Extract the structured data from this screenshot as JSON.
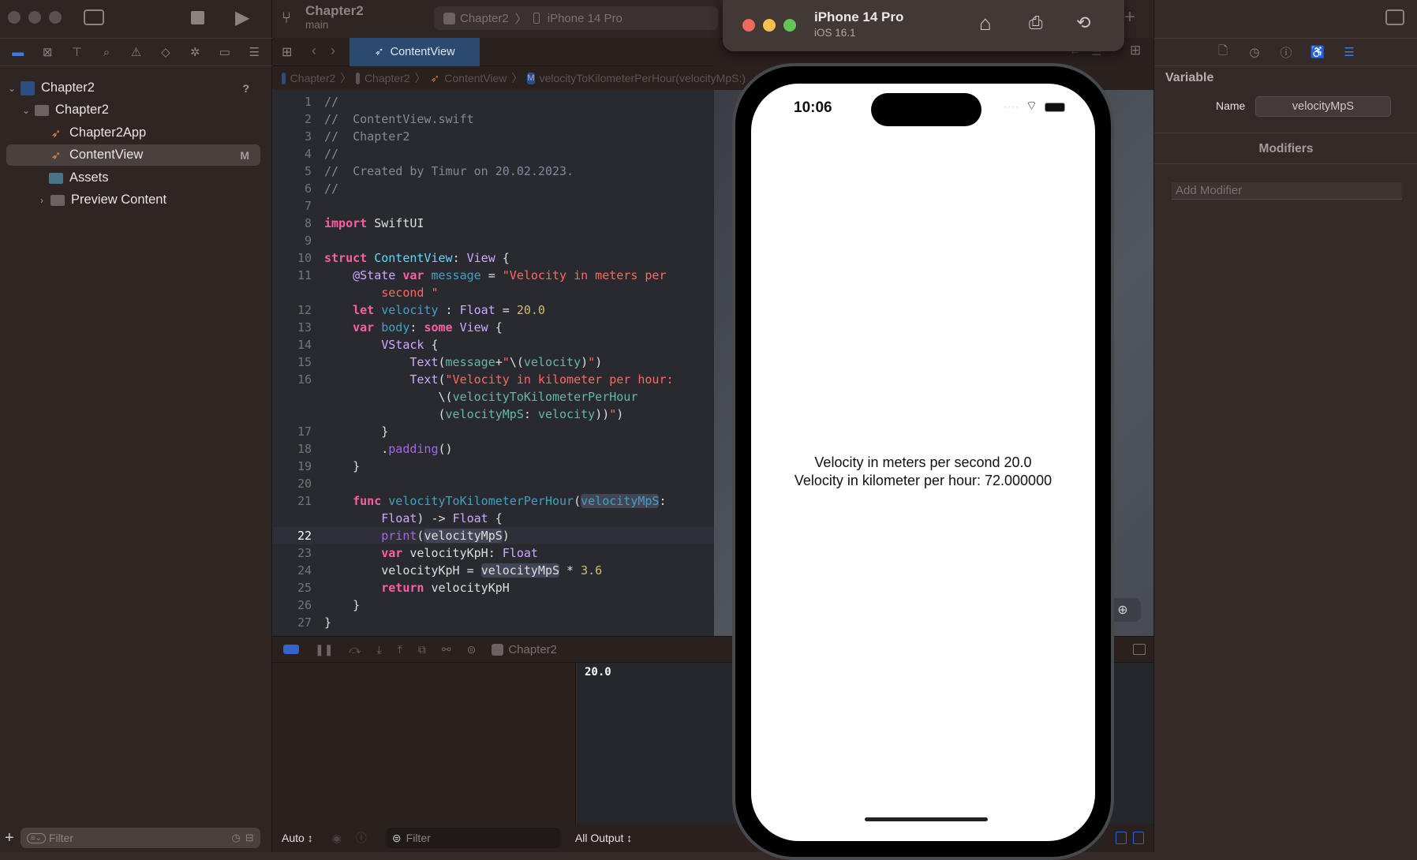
{
  "toolbar": {
    "project": "Chapter2",
    "branch": "main",
    "scheme": "Chapter2",
    "destination": "iPhone 14 Pro",
    "add": "+"
  },
  "navigator": {
    "tree": [
      {
        "label": "Chapter2",
        "badge": "?",
        "kind": "project",
        "expanded": true
      },
      {
        "label": "Chapter2",
        "kind": "folder",
        "expanded": true
      },
      {
        "label": "Chapter2App",
        "kind": "swift"
      },
      {
        "label": "ContentView",
        "kind": "swift",
        "badge": "M",
        "selected": true
      },
      {
        "label": "Assets",
        "kind": "assets"
      },
      {
        "label": "Preview Content",
        "kind": "folder",
        "expanded": false
      }
    ],
    "filter_placeholder": "Filter",
    "add": "+"
  },
  "editor": {
    "tab": "ContentView",
    "breadcrumb": [
      "Chapter2",
      "Chapter2",
      "ContentView",
      "velocityToKilometerPerHour(velocityMpS:)"
    ],
    "breadcrumb_method_badge": "M",
    "current_line": 22,
    "lines": [
      {
        "n": "1",
        "html": "<span class='cm'>//</span>"
      },
      {
        "n": "2",
        "html": "<span class='cm'>//  ContentView.swift</span>"
      },
      {
        "n": "3",
        "html": "<span class='cm'>//  Chapter2</span>"
      },
      {
        "n": "4",
        "html": "<span class='cm'>//</span>"
      },
      {
        "n": "5",
        "html": "<span class='cm'>//  Created by Timur on 20.02.2023.</span>"
      },
      {
        "n": "6",
        "html": "<span class='cm'>//</span>"
      },
      {
        "n": "7",
        "html": ""
      },
      {
        "n": "8",
        "html": "<span class='kw'>import</span> SwiftUI"
      },
      {
        "n": "9",
        "html": ""
      },
      {
        "n": "10",
        "html": "<span class='kw'>struct</span> <span class='dec'>ContentView</span>: <span class='ty'>View</span> {"
      },
      {
        "n": "11",
        "html": "    <span class='ty'>@State</span> <span class='kw'>var</span> <span class='id'>message</span> = <span class='str'>\"Velocity in meters per</span>"
      },
      {
        "n": "",
        "html": "        <span class='str'>second \"</span>"
      },
      {
        "n": "12",
        "html": "    <span class='kw'>let</span> <span class='id'>velocity</span> : <span class='ty'>Float</span> = <span class='num'>20.0</span>"
      },
      {
        "n": "13",
        "html": "    <span class='kw'>var</span> <span class='id'>body</span>: <span class='kw'>some</span> <span class='ty'>View</span> {"
      },
      {
        "n": "14",
        "html": "        <span class='ty'>VStack</span> {"
      },
      {
        "n": "15",
        "html": "            <span class='ty'>Text</span>(<span class='fn'>message</span>+<span class='str'>\"</span>\\(<span class='fn'>velocity</span>)<span class='str'>\"</span>)"
      },
      {
        "n": "16",
        "html": "            <span class='ty'>Text</span>(<span class='str'>\"Velocity in kilometer per hour:</span>"
      },
      {
        "n": "",
        "html": "                \\(<span class='fn'>velocityToKilometerPerHour</span>"
      },
      {
        "n": "",
        "html": "                (<span class='fn'>velocityMpS</span>: <span class='fn'>velocity</span>))<span class='str'>\"</span>)"
      },
      {
        "n": "17",
        "html": "        }"
      },
      {
        "n": "18",
        "html": "        .<span class='pr'>padding</span>()"
      },
      {
        "n": "19",
        "html": "    }"
      },
      {
        "n": "20",
        "html": ""
      },
      {
        "n": "21",
        "html": "    <span class='kw'>func</span> <span class='dec' style='color:#41a1c0'>velocityToKilometerPerHour</span>(<span class='id hl'>velocityMpS</span>:"
      },
      {
        "n": "",
        "html": "        <span class='ty'>Float</span>) -> <span class='ty'>Float</span> {"
      },
      {
        "n": "22",
        "html": "        <span class='pr'>print</span>(<span class='hl'>velocityMpS</span>)"
      },
      {
        "n": "23",
        "html": "        <span class='kw'>var</span> velocityKpH: <span class='ty'>Float</span>"
      },
      {
        "n": "24",
        "html": "        velocityKpH = <span class='hl'>velocityMpS</span> * <span class='num'>3.6</span>"
      },
      {
        "n": "25",
        "html": "        <span class='kw'>return</span> velocityKpH"
      },
      {
        "n": "26",
        "html": "    }"
      },
      {
        "n": "27",
        "html": "}"
      }
    ]
  },
  "debug": {
    "target": "Chapter2",
    "console_output": "20.0",
    "auto_label": "Auto ↕",
    "filter_placeholder": "Filter",
    "output_select": "All Output ↕"
  },
  "simulator": {
    "device": "iPhone 14 Pro",
    "os": "iOS 16.1",
    "time": "10:06",
    "text_line1": "Velocity in meters per second 20.0",
    "text_line2": "Velocity in kilometer per hour: 72.000000"
  },
  "inspector": {
    "section": "Variable",
    "name_label": "Name",
    "name_value": "velocityMpS",
    "modifiers_title": "Modifiers",
    "add_modifier_placeholder": "Add Modifier"
  },
  "colors": {
    "accent": "#2c4a70",
    "traffic_red": "#ed6a5e",
    "traffic_yellow": "#f5bf4f",
    "traffic_green": "#61c554"
  }
}
